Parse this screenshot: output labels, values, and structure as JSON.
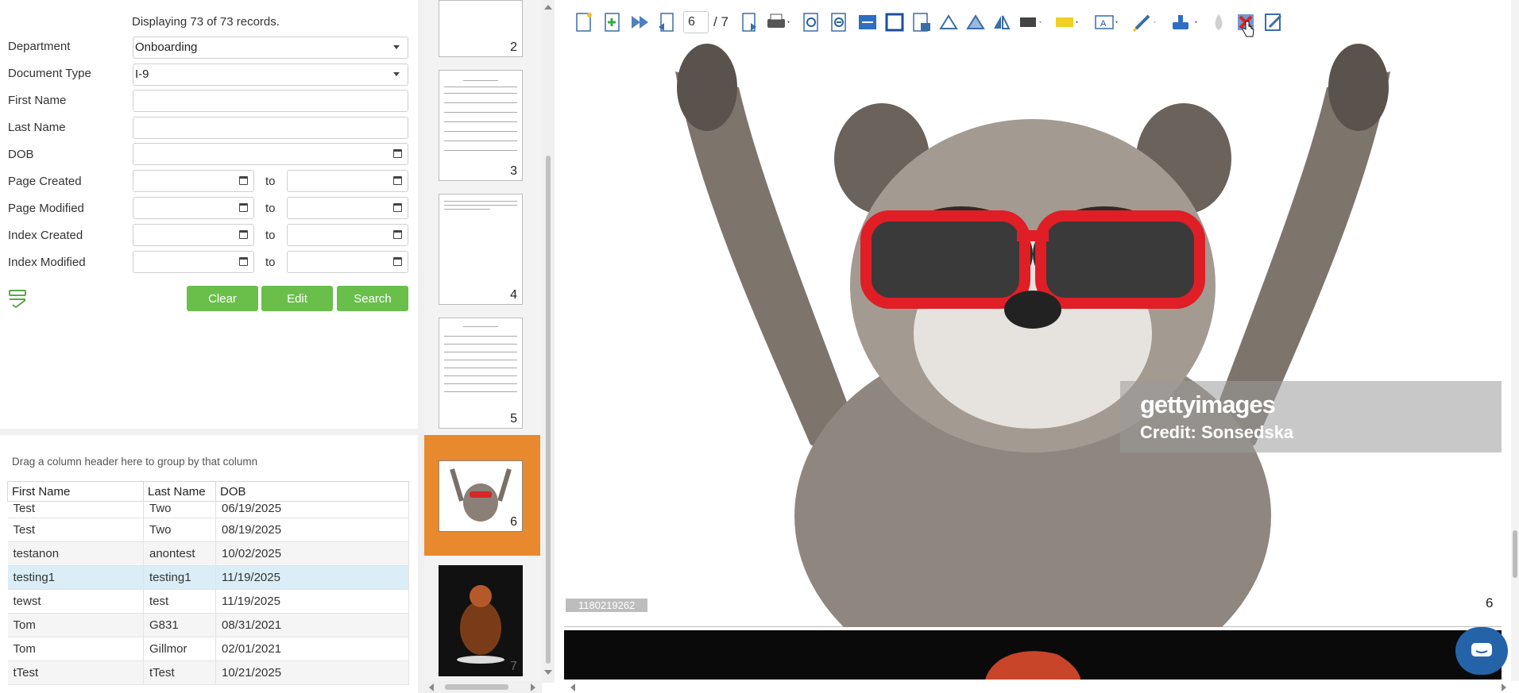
{
  "search": {
    "records_text": "Displaying 73 of 73 records.",
    "fields": {
      "department_label": "Department",
      "department_value": "Onboarding",
      "doctype_label": "Document Type",
      "doctype_value": "I-9",
      "first_name_label": "First Name",
      "last_name_label": "Last Name",
      "dob_label": "DOB",
      "page_created_label": "Page Created",
      "page_modified_label": "Page Modified",
      "index_created_label": "Index Created",
      "index_modified_label": "Index Modified",
      "to_label": "to"
    },
    "buttons": {
      "clear": "Clear",
      "edit": "Edit",
      "search": "Search"
    }
  },
  "grid": {
    "group_hint": "Drag a column header here to group by that column",
    "columns": [
      "First Name",
      "Last Name",
      "DOB"
    ],
    "rows": [
      [
        "Test",
        "Two",
        "06/19/2025"
      ],
      [
        "Test",
        "Two",
        "08/19/2025"
      ],
      [
        "testanon",
        "anontest",
        "10/02/2025"
      ],
      [
        "testing1",
        "testing1",
        "11/19/2025"
      ],
      [
        "tewst",
        "test",
        "11/19/2025"
      ],
      [
        "Tom",
        "G831",
        "08/31/2021"
      ],
      [
        "Tom",
        "Gillmor",
        "02/01/2021"
      ],
      [
        "tTest",
        "tTest",
        "10/21/2025"
      ]
    ],
    "selected_row": 3
  },
  "thumbnails": [
    "2",
    "3",
    "4",
    "5",
    "6",
    "7"
  ],
  "viewer": {
    "page_current": "6",
    "page_total": "/ 7",
    "image_watermark": "gettyimages",
    "image_credit": "Credit: Sonsedska",
    "image_id": "1180219262",
    "page_number_label": "6",
    "accent": "#e8892e"
  }
}
